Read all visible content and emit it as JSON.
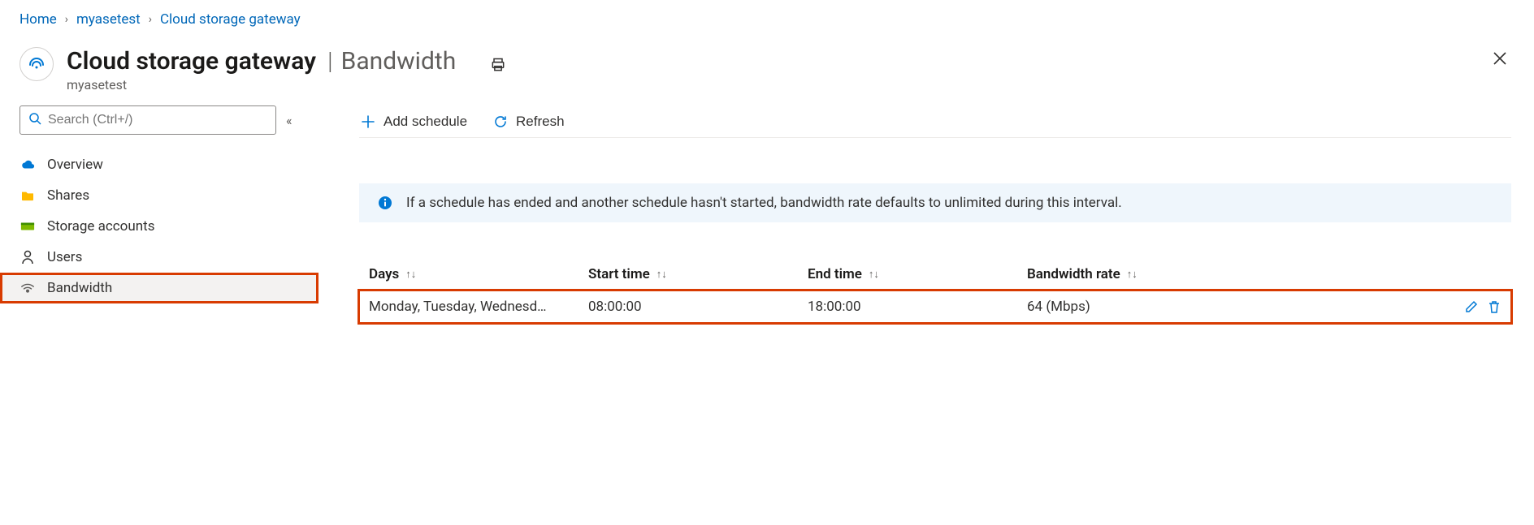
{
  "breadcrumb": {
    "items": [
      {
        "label": "Home"
      },
      {
        "label": "myasetest"
      },
      {
        "label": "Cloud storage gateway"
      }
    ]
  },
  "header": {
    "title": "Cloud storage gateway",
    "section": "Bandwidth",
    "subtitle": "myasetest"
  },
  "search": {
    "placeholder": "Search (Ctrl+/)"
  },
  "sidebar": {
    "items": [
      {
        "label": "Overview",
        "icon": "cloud",
        "selected": false
      },
      {
        "label": "Shares",
        "icon": "folder",
        "selected": false
      },
      {
        "label": "Storage accounts",
        "icon": "storage",
        "selected": false
      },
      {
        "label": "Users",
        "icon": "person",
        "selected": false
      },
      {
        "label": "Bandwidth",
        "icon": "wifi",
        "selected": true
      }
    ]
  },
  "toolbar": {
    "add_label": "Add schedule",
    "refresh_label": "Refresh"
  },
  "banner": {
    "text": "If a schedule has ended and another schedule hasn't started, bandwidth rate defaults to unlimited during this interval."
  },
  "table": {
    "columns": {
      "days": "Days",
      "start": "Start time",
      "end": "End time",
      "rate": "Bandwidth rate"
    },
    "rows": [
      {
        "days": "Monday, Tuesday, Wednesd…",
        "start": "08:00:00",
        "end": "18:00:00",
        "rate": "64 (Mbps)"
      }
    ]
  }
}
